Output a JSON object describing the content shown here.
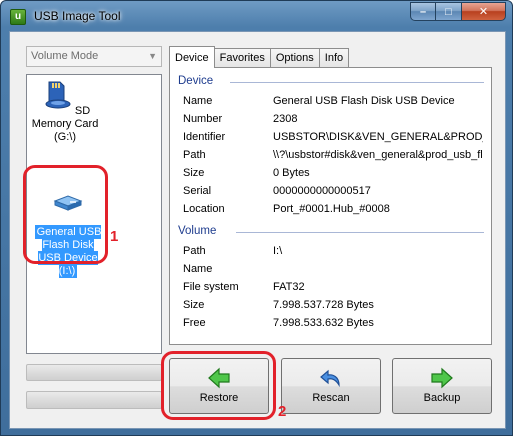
{
  "window": {
    "title": "USB Image Tool",
    "app_icon_glyph": "u",
    "minimize_glyph": "–",
    "maximize_glyph": "□",
    "close_glyph": "✕"
  },
  "volume_mode": {
    "selected": "Volume Mode"
  },
  "drives": [
    {
      "label": "SD Memory Card (G:\\)",
      "icon": "sd-card-icon",
      "selected": false
    },
    {
      "label": "General USB Flash Disk USB Device (I:\\)",
      "icon": "usb-drive-icon",
      "selected": true
    }
  ],
  "tabs": [
    {
      "label": "Device",
      "active": true
    },
    {
      "label": "Favorites",
      "active": false
    },
    {
      "label": "Options",
      "active": false
    },
    {
      "label": "Info",
      "active": false
    }
  ],
  "device_group": {
    "header": "Device",
    "rows": [
      {
        "key": "Name",
        "value": "General USB Flash Disk USB Device"
      },
      {
        "key": "Number",
        "value": "2308"
      },
      {
        "key": "Identifier",
        "value": "USBSTOR\\DISK&VEN_GENERAL&PROD_"
      },
      {
        "key": "Path",
        "value": "\\\\?\\usbstor#disk&ven_general&prod_usb_fla"
      },
      {
        "key": "Size",
        "value": "0 Bytes"
      },
      {
        "key": "Serial",
        "value": "0000000000000517"
      },
      {
        "key": "Location",
        "value": "Port_#0001.Hub_#0008"
      }
    ]
  },
  "volume_group": {
    "header": "Volume",
    "rows": [
      {
        "key": "Path",
        "value": "I:\\"
      },
      {
        "key": "Name",
        "value": ""
      },
      {
        "key": "File system",
        "value": "FAT32"
      },
      {
        "key": "Size",
        "value": "7.998.537.728 Bytes"
      },
      {
        "key": "Free",
        "value": "7.998.533.632 Bytes"
      }
    ]
  },
  "buttons": {
    "restore": "Restore",
    "rescan": "Rescan",
    "backup": "Backup"
  },
  "annotations": {
    "first": "1",
    "second": "2"
  },
  "colors": {
    "selection": "#3399ff",
    "annotation": "#e2212a",
    "group_header": "#1e3c8e",
    "arrow_green": "#3cb043"
  }
}
